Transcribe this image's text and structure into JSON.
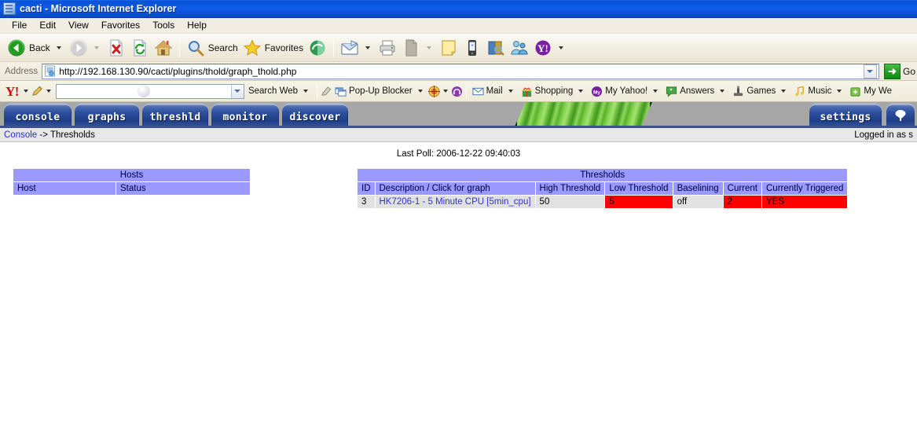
{
  "window": {
    "title": "cacti - Microsoft Internet Explorer",
    "icon": "page-icon"
  },
  "menubar": {
    "items": [
      {
        "label": "File"
      },
      {
        "label": "Edit"
      },
      {
        "label": "View"
      },
      {
        "label": "Favorites"
      },
      {
        "label": "Tools"
      },
      {
        "label": "Help"
      }
    ]
  },
  "toolbar": {
    "back_label": "Back",
    "search_label": "Search",
    "favorites_label": "Favorites",
    "icons": {
      "back": "back-arrow-icon",
      "forward": "forward-arrow-icon",
      "stop": "stop-icon",
      "refresh": "refresh-icon",
      "home": "home-icon",
      "search": "magnifier-icon",
      "favorites": "star-icon",
      "history": "history-icon",
      "mail": "mail-icon",
      "print": "printer-icon",
      "edit": "edit-page-icon",
      "notes": "note-icon",
      "messenger_phone": "phone-icon",
      "encarta": "book-icon",
      "messenger": "people-icon",
      "yahoo": "yahoo-icon"
    }
  },
  "address": {
    "label": "Address",
    "url": "http://192.168.130.90/cacti/plugins/thold/graph_thold.php",
    "go_label": "Go"
  },
  "yahoo_toolbar": {
    "logo": "Y!",
    "search_placeholder": "",
    "search_value": "",
    "search_web_label": "Search Web",
    "popup_blocker_label": "Pop-Up Blocker",
    "items": [
      {
        "label": "Mail",
        "icon": "envelope-icon"
      },
      {
        "label": "Shopping",
        "icon": "gift-icon"
      },
      {
        "label": "My Yahoo!",
        "icon": "my-yahoo-icon"
      },
      {
        "label": "Answers",
        "icon": "answers-icon"
      },
      {
        "label": "Games",
        "icon": "games-icon"
      },
      {
        "label": "Music",
        "icon": "music-note-icon"
      },
      {
        "label": "My We",
        "icon": "my-web-icon"
      }
    ]
  },
  "cacti_nav": {
    "tabs": [
      {
        "label": "console"
      },
      {
        "label": "graphs"
      },
      {
        "label": "threshld"
      },
      {
        "label": "monitor"
      },
      {
        "label": "discover"
      }
    ],
    "right_tabs": [
      {
        "label": "settings"
      }
    ],
    "tree_tab_icon": "tree-icon"
  },
  "breadcrumb": {
    "root": "Console",
    "separator": " -> ",
    "current": "Thresholds",
    "logged_in": "Logged in as s"
  },
  "page": {
    "last_poll": "Last Poll: 2006-12-22 09:40:03"
  },
  "hosts_table": {
    "title": "Hosts",
    "columns": [
      "Host",
      "Status"
    ],
    "rows": []
  },
  "thresholds_table": {
    "title": "Thresholds",
    "columns": [
      "ID",
      "Description / Click for graph",
      "High Threshold",
      "Low Threshold",
      "Baselining",
      "Current",
      "Currently Triggered"
    ],
    "rows": [
      {
        "id": "3",
        "description": "HK7206-1 - 5 Minute CPU [5min_cpu]",
        "high_threshold": "50",
        "low_threshold": "5",
        "low_threshold_alert": true,
        "baselining": "off",
        "current": "2",
        "current_alert": true,
        "currently_triggered": "YES",
        "triggered_alert": true
      }
    ]
  },
  "colors": {
    "titlebar_blue": "#0d5ce8",
    "table_header": "#9999ff",
    "table_cell": "#e1e1e1",
    "alert_red": "#ff0000",
    "link_blue": "#3333cc",
    "nav_tab_blue": "#2c4f9e",
    "nav_background": "#a6a6a6"
  }
}
